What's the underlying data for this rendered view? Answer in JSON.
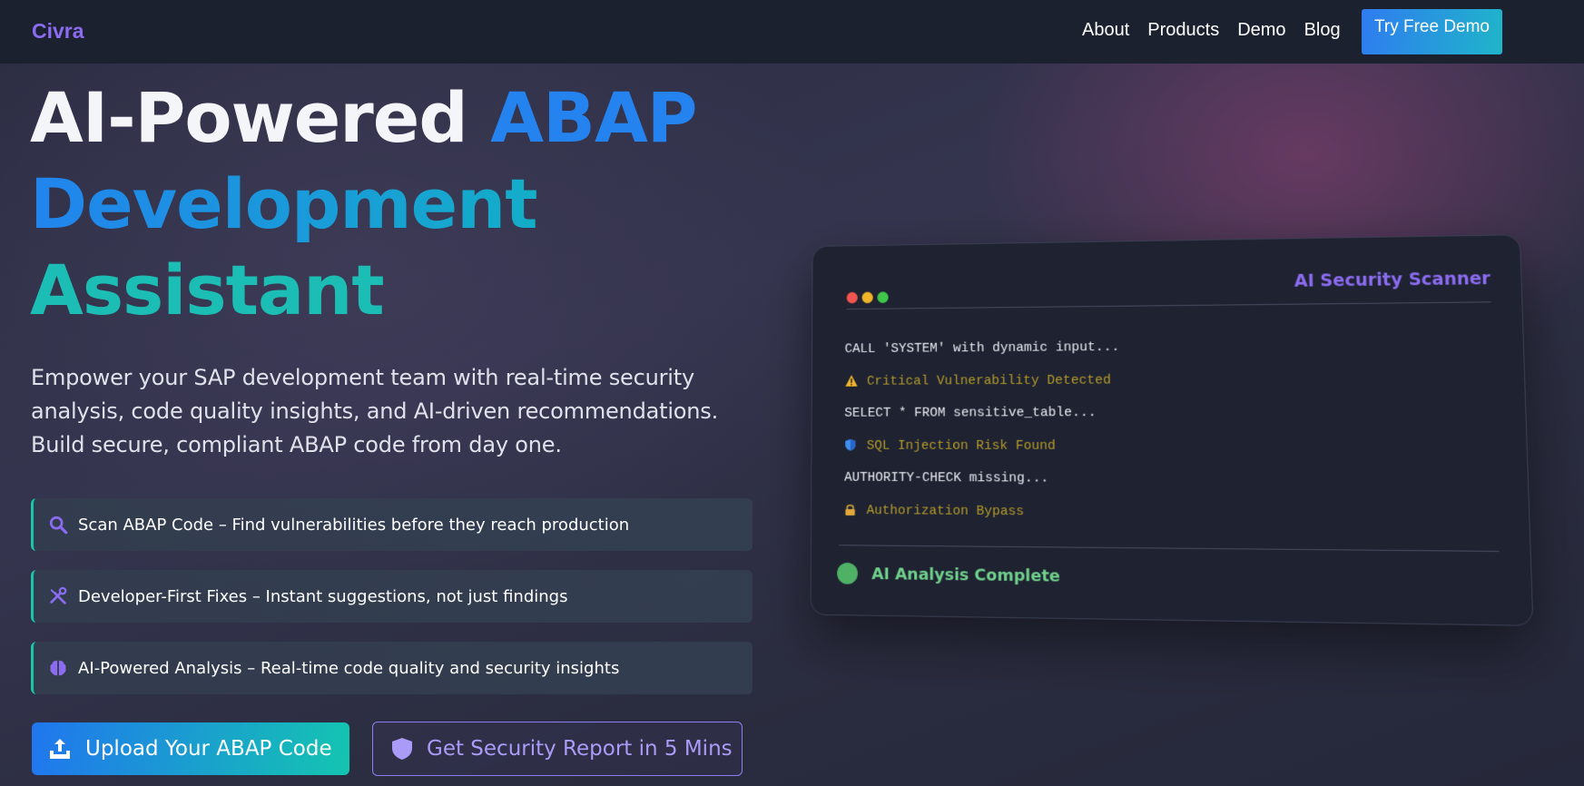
{
  "nav": {
    "brand": "Civra",
    "links": [
      "About",
      "Products",
      "Demo",
      "Blog"
    ],
    "cta": "Try Free Demo"
  },
  "hero": {
    "title_part1": "AI-Powered ",
    "title_part2": "ABAP",
    "title_part3": "Development",
    "title_part4": "Assistant",
    "lede": "Empower your SAP development team with real-time security analysis, code quality insights, and AI-driven recommendations. Build secure, compliant ABAP code from day one."
  },
  "features": [
    {
      "icon": "search-icon",
      "text": "Scan ABAP Code – Find vulnerabilities before they reach production"
    },
    {
      "icon": "tools-icon",
      "text": "Developer-First Fixes – Instant suggestions, not just findings"
    },
    {
      "icon": "brain-icon",
      "text": "AI-Powered Analysis – Real-time code quality and security insights"
    }
  ],
  "buttons": {
    "upload": "Upload Your ABAP Code",
    "report": "Get Security Report in 5 Mins"
  },
  "scanner": {
    "title": "AI Security Scanner",
    "lines": [
      {
        "kind": "code",
        "icon": "",
        "text": "CALL 'SYSTEM' with dynamic input..."
      },
      {
        "kind": "warn",
        "icon": "warning-icon",
        "text": "Critical Vulnerability Detected"
      },
      {
        "kind": "code",
        "icon": "",
        "text": "SELECT * FROM sensitive_table..."
      },
      {
        "kind": "warn",
        "icon": "shield-icon",
        "text": "SQL Injection Risk Found"
      },
      {
        "kind": "code",
        "icon": "",
        "text": "AUTHORITY-CHECK missing..."
      },
      {
        "kind": "warn",
        "icon": "lock-icon",
        "text": "Authorization Bypass"
      }
    ],
    "status": "AI Analysis Complete"
  },
  "colors": {
    "accent_purple": "#8b6cf0",
    "accent_blue": "#2583f0",
    "accent_teal": "#1bbdb4",
    "warning_text": "#b49b2a",
    "success_green": "#6fd08b",
    "dot_red": "#f0564f",
    "dot_yellow": "#f0b429",
    "dot_green": "#3fc74a"
  }
}
